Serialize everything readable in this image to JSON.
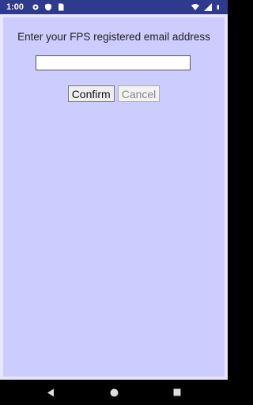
{
  "status_bar": {
    "time": "1:00",
    "icons_left": [
      "gear-icon",
      "shield-icon",
      "sim-card-icon"
    ],
    "icons_right": [
      "wifi-icon",
      "signal-icon",
      "battery-icon"
    ]
  },
  "form": {
    "prompt": "Enter your FPS registered email address",
    "email_value": "",
    "confirm_label": "Confirm",
    "cancel_label": "Cancel"
  },
  "nav": {
    "icons": [
      "back-icon",
      "home-icon",
      "recents-icon"
    ]
  },
  "colors": {
    "status_bar": "#2d3a8e",
    "panel": "#ccccff",
    "panel_border": "#e6e6ff"
  }
}
